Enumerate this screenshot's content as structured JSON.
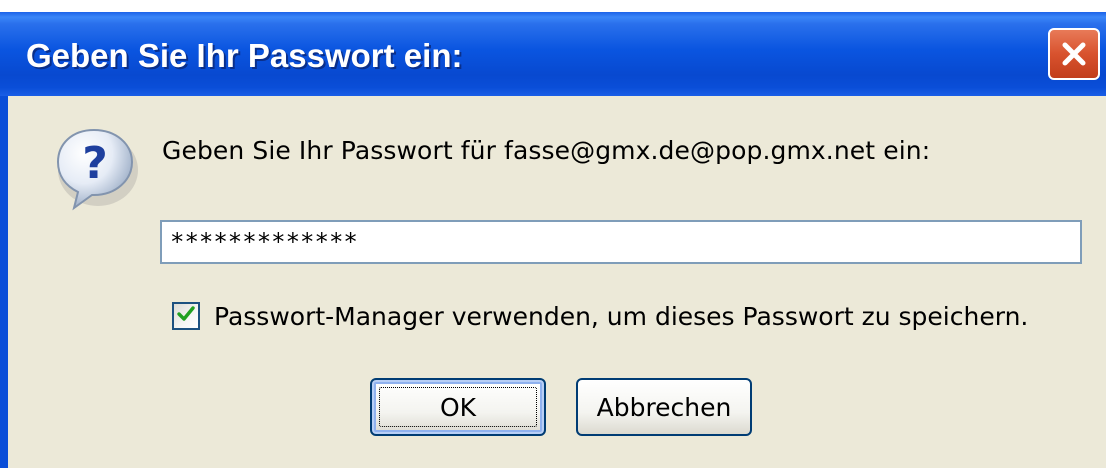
{
  "window": {
    "title": "Geben Sie Ihr Passwort ein:",
    "close_icon": "close-icon"
  },
  "dialog": {
    "icon": "question-icon",
    "prompt": "Geben Sie Ihr Passwort für fasse@gmx.de@pop.gmx.net ein:",
    "password_value": "*************",
    "save_password": {
      "checked": true,
      "label": "Passwort-Manager verwenden, um dieses Passwort zu speichern."
    },
    "buttons": {
      "ok_label": "OK",
      "cancel_label": "Abbrechen"
    }
  },
  "colors": {
    "titlebar": "#0a55e0",
    "body_bg": "#ece9d8",
    "close_button": "#d8522e",
    "checkmark": "#21a121"
  }
}
